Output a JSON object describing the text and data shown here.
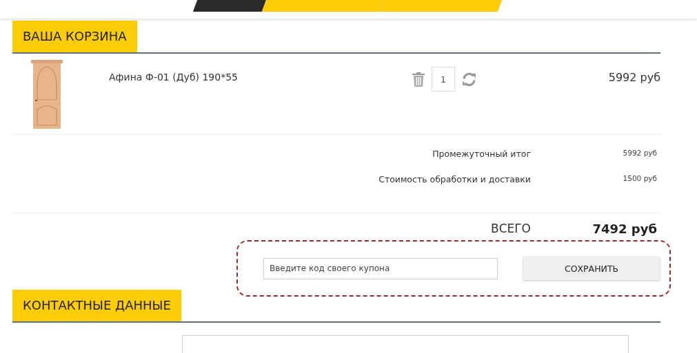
{
  "nav": {
    "tabs": [
      {
        "selected": true
      },
      {
        "selected": false
      },
      {
        "selected": false
      }
    ]
  },
  "cart": {
    "title": "ВАША КОРЗИНА",
    "items": [
      {
        "name": "Афина Ф-01 (Дуб) 190*55",
        "quantity": "1",
        "price": "5992 руб"
      }
    ],
    "summary": [
      {
        "label": "Промежуточный итог",
        "value": "5992 руб"
      },
      {
        "label": "Стоимость обработки и доставки",
        "value": "1500 руб"
      }
    ],
    "total": {
      "label": "ВСЕГО",
      "value": "7492 руб"
    },
    "coupon": {
      "placeholder": "Введите код своего купона",
      "button": "СОХРАНИТЬ"
    }
  },
  "contacts": {
    "title": "КОНТАКТНЫЕ ДАННЫЕ"
  }
}
